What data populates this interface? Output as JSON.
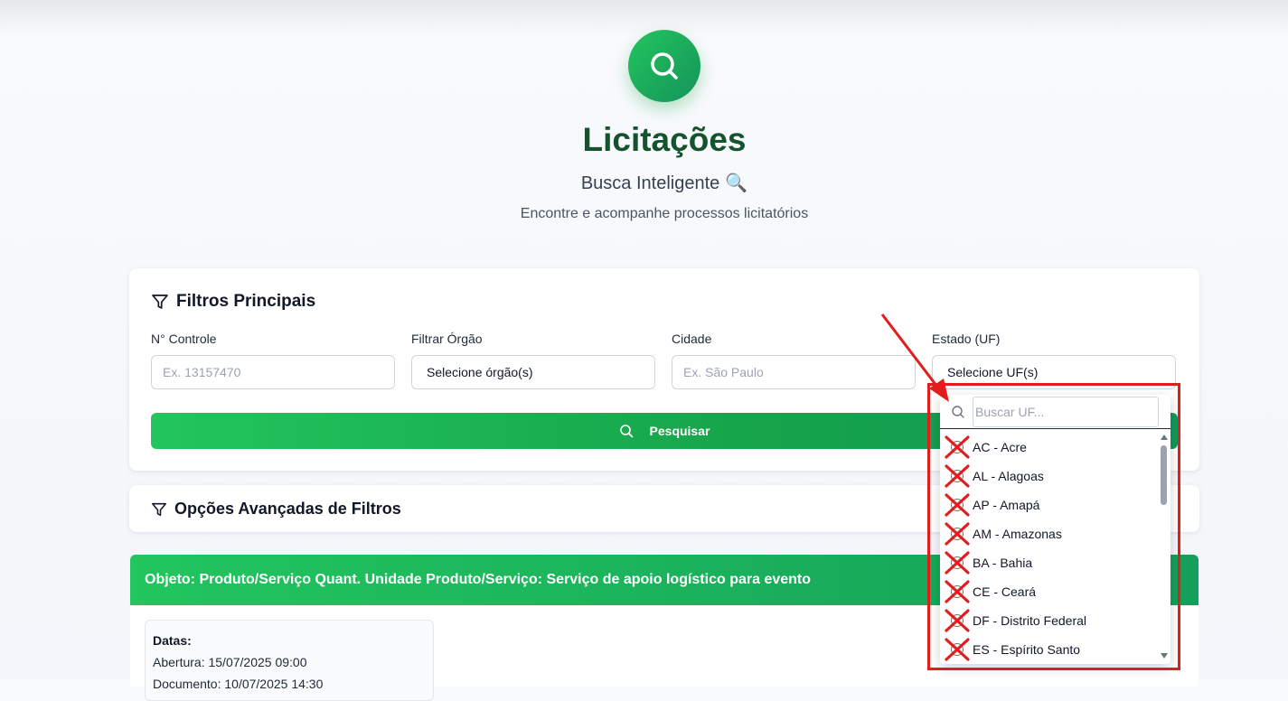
{
  "header": {
    "title": "Licitações",
    "subtitle": "Busca Inteligente",
    "subtitle_emoji": "🔍",
    "tagline": "Encontre e acompanhe processos licitatórios"
  },
  "main_filters": {
    "title": "Filtros Principais",
    "fields": [
      {
        "label": "N° Controle",
        "placeholder": "Ex. 13157470",
        "type": "input"
      },
      {
        "label": "Filtrar Órgão",
        "value": "Selecione órgão(s)",
        "type": "select"
      },
      {
        "label": "Cidade",
        "placeholder": "Ex. São Paulo",
        "type": "input"
      },
      {
        "label": "Estado (UF)",
        "value": "Selecione UF(s)",
        "type": "select"
      }
    ],
    "search_button": "Pesquisar"
  },
  "advanced_filters": {
    "title": "Opções Avançadas de Filtros"
  },
  "result": {
    "header": "Objeto: Produto/Serviço Quant. Unidade Produto/Serviço: Serviço de apoio logístico para evento",
    "dates_title": "Datas:",
    "abertura_label": "Abertura:",
    "abertura_value": "15/07/2025 09:00",
    "documento_label": "Documento:",
    "documento_value": "10/07/2025 14:30"
  },
  "uf_dropdown": {
    "search_placeholder": "Buscar UF...",
    "options": [
      "AC - Acre",
      "AL - Alagoas",
      "AP - Amapá",
      "AM - Amazonas",
      "BA - Bahia",
      "CE - Ceará",
      "DF - Distrito Federal",
      "ES - Espírito Santo"
    ]
  },
  "colors": {
    "brand_green": "#16a34a",
    "title_green": "#14532d",
    "annotation_red": "#e11d1d"
  }
}
